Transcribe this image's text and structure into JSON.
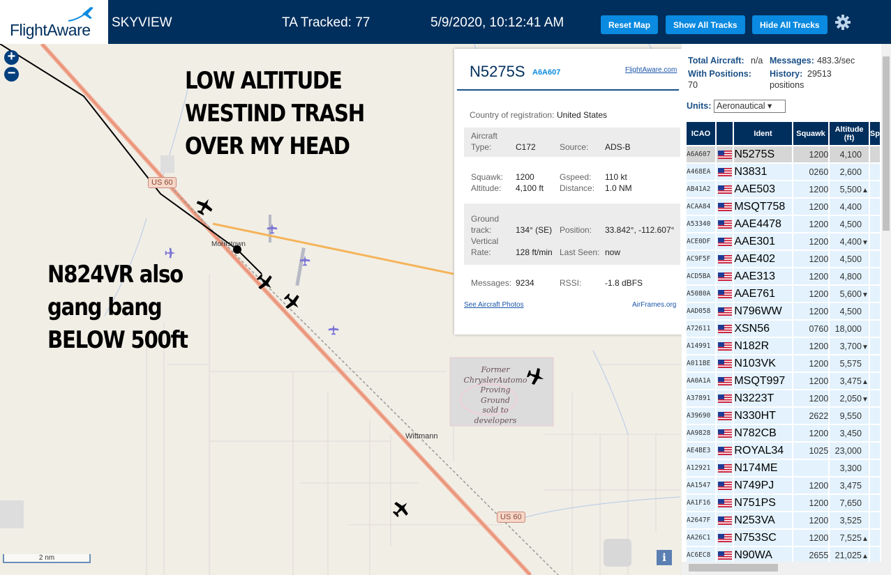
{
  "header": {
    "logo": "FlightAware",
    "app_name": "SKYVIEW",
    "tracked": "TA Tracked: 77",
    "datetime": "5/9/2020, 10:12:41 AM",
    "buttons": {
      "reset": "Reset Map",
      "show": "Show All Tracks",
      "hide": "Hide All Tracks"
    },
    "icons": {
      "settings": "gear-icon",
      "logo": "plane-logo-icon"
    }
  },
  "map": {
    "zoom_in": "+",
    "zoom_out": "−",
    "annotation_top": [
      "LOW ALTITUDE",
      "WESTIND TRASH",
      "OVER MY HEAD"
    ],
    "annotation_left": [
      "N824VR also",
      "gang bang",
      "BELOW 500ft"
    ],
    "places": {
      "morristown": "Morristown",
      "wittmann": "Wittmann"
    },
    "road_shields": {
      "us60_a": "US 60",
      "us60_b": "US 60"
    },
    "proving_ground": [
      "Former",
      "ChryslerAutomo",
      "Proving",
      "Ground",
      "sold to",
      "developers"
    ],
    "scale": "2 nm",
    "info": "i"
  },
  "popup": {
    "ident": "N5275S",
    "hex": "A6A607",
    "fa_link": "FlightAware.com",
    "country_label": "Country of registration:",
    "country_value": "United States",
    "aircraft_type_label": [
      "Aircraft",
      "Type:"
    ],
    "aircraft_type_value": "C172",
    "source_label": "Source:",
    "source_value": "ADS-B",
    "squawk_label": "Squawk:",
    "squawk_value": "1200",
    "altitude_label": "Altitude:",
    "altitude_value": "4,100 ft",
    "gspeed_label": "Gspeed:",
    "gspeed_value": "110 kt",
    "distance_label": "Distance:",
    "distance_value": "1.0 NM",
    "track_label": [
      "Ground",
      "track:"
    ],
    "track_value": "134° (SE)",
    "position_label": "Position:",
    "position_value": "33.842°, -112.607°",
    "vrate_label": [
      "Vertical",
      "Rate:"
    ],
    "vrate_value": "128 ft/min",
    "lastseen_label": "Last Seen:",
    "lastseen_value": "now",
    "messages_label": "Messages:",
    "messages_value": "9234",
    "rssi_label": "RSSI:",
    "rssi_value": "-1.8 dBFS",
    "photos_link": "See Aircraft Photos",
    "airframes_link": "AirFrames.org"
  },
  "panel": {
    "total_label": "Total Aircraft:",
    "total_value": "n/a",
    "messages_label": "Messages:",
    "messages_value": "483.3/sec",
    "withpos_label": "With Positions:",
    "withpos_value": "70",
    "history_label": "History:",
    "history_value": "29513",
    "history_unit": "positions",
    "units_label": "Units:",
    "units_value": "Aeronautical ▾",
    "columns": {
      "icao": "ICAO",
      "ident": "Ident",
      "squawk": "Squawk",
      "alt1": "Altitude",
      "alt2": "(ft)",
      "sp": "Sp"
    },
    "rows": [
      {
        "icao": "A6A607",
        "ident": "N5275S",
        "squawk": "1200",
        "alt": "4,100",
        "trend": "",
        "selected": true
      },
      {
        "icao": "A468EA",
        "ident": "N3831",
        "squawk": "0260",
        "alt": "2,600",
        "trend": ""
      },
      {
        "icao": "AB41A2",
        "ident": "AAE503",
        "squawk": "1200",
        "alt": "5,500",
        "trend": "▲"
      },
      {
        "icao": "ACAA84",
        "ident": "MSQT758",
        "squawk": "1200",
        "alt": "4,400",
        "trend": ""
      },
      {
        "icao": "A53340",
        "ident": "AAE4478",
        "squawk": "1200",
        "alt": "4,500",
        "trend": ""
      },
      {
        "icao": "ACE0DF",
        "ident": "AAE301",
        "squawk": "1200",
        "alt": "4,400",
        "trend": "▼"
      },
      {
        "icao": "AC9F5F",
        "ident": "AAE402",
        "squawk": "1200",
        "alt": "4,500",
        "trend": ""
      },
      {
        "icao": "ACD5BA",
        "ident": "AAE313",
        "squawk": "1200",
        "alt": "4,800",
        "trend": ""
      },
      {
        "icao": "A5080A",
        "ident": "AAE761",
        "squawk": "1200",
        "alt": "5,600",
        "trend": "▼"
      },
      {
        "icao": "AAD058",
        "ident": "N796WW",
        "squawk": "1200",
        "alt": "4,500",
        "trend": ""
      },
      {
        "icao": "A72611",
        "ident": "XSN56",
        "squawk": "0760",
        "alt": "18,000",
        "trend": ""
      },
      {
        "icao": "A14991",
        "ident": "N182R",
        "squawk": "1200",
        "alt": "3,700",
        "trend": "▼"
      },
      {
        "icao": "A011BE",
        "ident": "N103VK",
        "squawk": "1200",
        "alt": "5,575",
        "trend": ""
      },
      {
        "icao": "AA0A1A",
        "ident": "MSQT997",
        "squawk": "1200",
        "alt": "3,475",
        "trend": "▲"
      },
      {
        "icao": "A37891",
        "ident": "N3223T",
        "squawk": "1200",
        "alt": "2,050",
        "trend": "▼"
      },
      {
        "icao": "A39690",
        "ident": "N330HT",
        "squawk": "2622",
        "alt": "9,550",
        "trend": ""
      },
      {
        "icao": "AA9828",
        "ident": "N782CB",
        "squawk": "1200",
        "alt": "3,450",
        "trend": ""
      },
      {
        "icao": "AE4BE3",
        "ident": "ROYAL34",
        "squawk": "1025",
        "alt": "23,000",
        "trend": ""
      },
      {
        "icao": "A12921",
        "ident": "N174ME",
        "squawk": "",
        "alt": "3,300",
        "trend": ""
      },
      {
        "icao": "AA1547",
        "ident": "N749PJ",
        "squawk": "1200",
        "alt": "3,475",
        "trend": ""
      },
      {
        "icao": "AA1F16",
        "ident": "N751PS",
        "squawk": "1200",
        "alt": "7,650",
        "trend": ""
      },
      {
        "icao": "A2647F",
        "ident": "N253VA",
        "squawk": "1200",
        "alt": "3,525",
        "trend": ""
      },
      {
        "icao": "AA26C1",
        "ident": "N753SC",
        "squawk": "1200",
        "alt": "7,525",
        "trend": "▲"
      },
      {
        "icao": "AC6EC8",
        "ident": "N90WA",
        "squawk": "2655",
        "alt": "21,025",
        "trend": "▲"
      }
    ]
  },
  "colors": {
    "header_bg": "#002f5d",
    "button": "#0a8ae0",
    "row_bg": "#e3f2fd",
    "highway": "#f0a890",
    "aircraft_dark": "#000000",
    "aircraft_light": "#7b74d6"
  }
}
